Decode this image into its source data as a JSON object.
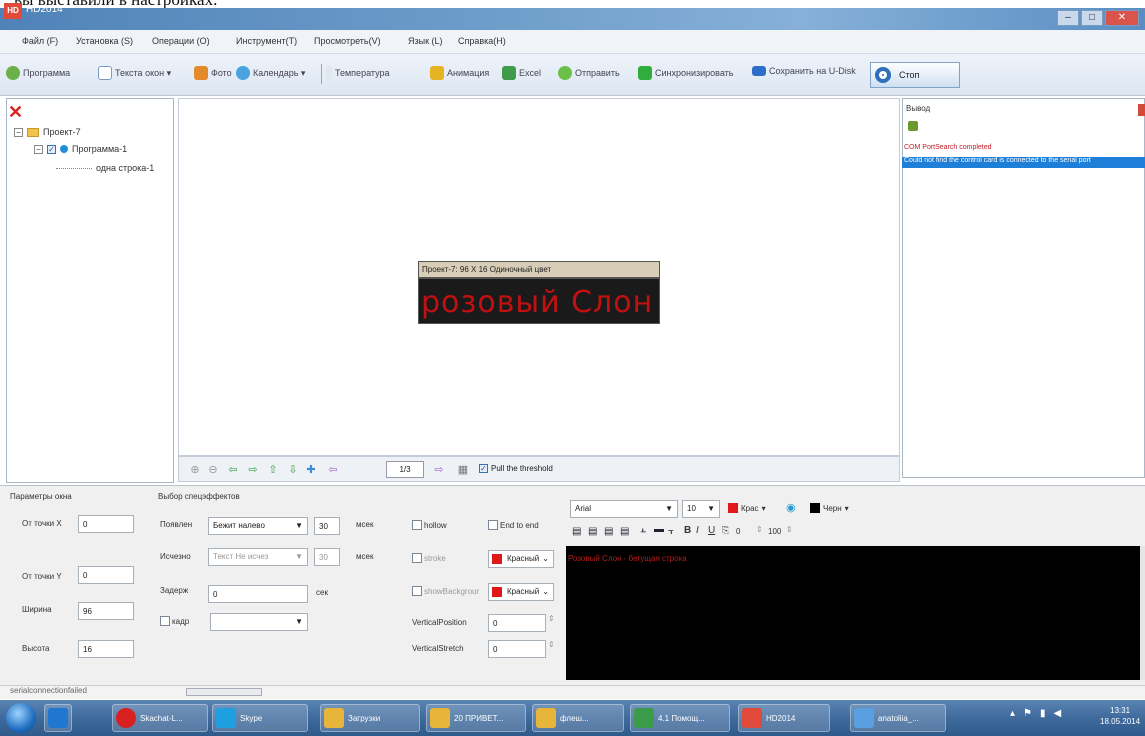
{
  "caption": "вы выставили в настройках.",
  "window": {
    "title": "HD2014",
    "minimize": "–",
    "maximize": "□",
    "close": "✕"
  },
  "menu": [
    "Файл (F)",
    "Установка (S)",
    "Операции (O)",
    "Инструмент(T)",
    "Просмотреть(V)",
    "Язык (L)",
    "Справка(H)"
  ],
  "toolbar": {
    "program": "Программа",
    "text_area": "Текста окон ▾",
    "photo": "Фото",
    "clock": "Календарь ▾",
    "temperature": "Температура",
    "animation": "Анимация",
    "excel": "Excel",
    "send": "Отправить",
    "sync": "Синхронизировать",
    "save_udisk": "Сохранить на U-Disk",
    "stop": "Стоп"
  },
  "tree": {
    "project": "Проект-7",
    "program": "Программа-1",
    "item": "одна строка-1"
  },
  "preview": {
    "header": "Проект-7: 96 X 16 Одиночный цвет",
    "text": "розовый Слон - бе"
  },
  "navbar": {
    "page": "1/3",
    "threshold": "Pull the threshold"
  },
  "output": {
    "title": "Вывод",
    "line1": "COM PortSearch completed",
    "line2": "Could not find the control card is connected to the serial port"
  },
  "window_params": {
    "title": "Параметры окна",
    "x_label": "От точки X",
    "x_value": "0",
    "y_label": "От точки Y",
    "y_value": "0",
    "width_label": "Ширина",
    "width_value": "96",
    "height_label": "Высота",
    "height_value": "16"
  },
  "effects": {
    "title": "Выбор спецэффектов",
    "appear_label": "Появлен",
    "appear_value": "Бежит налево",
    "appear_speed": "30",
    "appear_unit": "мсек",
    "disappear_label": "Исчезно",
    "disappear_value": "Текст Не исчез",
    "disappear_speed": "30",
    "disappear_unit": "мсек",
    "delay_label": "Задерж",
    "delay_value": "0",
    "delay_unit": "сек",
    "frame_label": "кадр",
    "hollow": "hollow",
    "end_to_end": "End to end",
    "stroke": "stroke",
    "stroke_color": "Красный",
    "show_bg": "showBackgrour",
    "bg_color": "Красный",
    "vpos_label": "VerticalPosition",
    "vpos_value": "0",
    "vstretch_label": "VerticalStretch",
    "vstretch_value": "0"
  },
  "format": {
    "font": "Arial",
    "size": "10",
    "fg_color": "Крас",
    "bg_color": "Черн",
    "bold": "B",
    "italic": "I",
    "underline": "U",
    "spacing": "0",
    "zoom": "100"
  },
  "editor": {
    "text": "Розовый Слон - бегущая строка"
  },
  "status": {
    "text": "serialconnectionfailed"
  },
  "taskbar": {
    "tasks": [
      "Skachat-L...",
      "Skype",
      "Загрузки",
      "20 ПРИВЕТ...",
      "флеш...",
      "4.1 Помощ...",
      "HD2014",
      "anatoliia_..."
    ],
    "clock_time": "13:31",
    "clock_date": "18.05.2014"
  },
  "colors": {
    "accent": "#1e7fd8",
    "led_red": "#c21010",
    "title_bar": "#5a8ec2"
  }
}
